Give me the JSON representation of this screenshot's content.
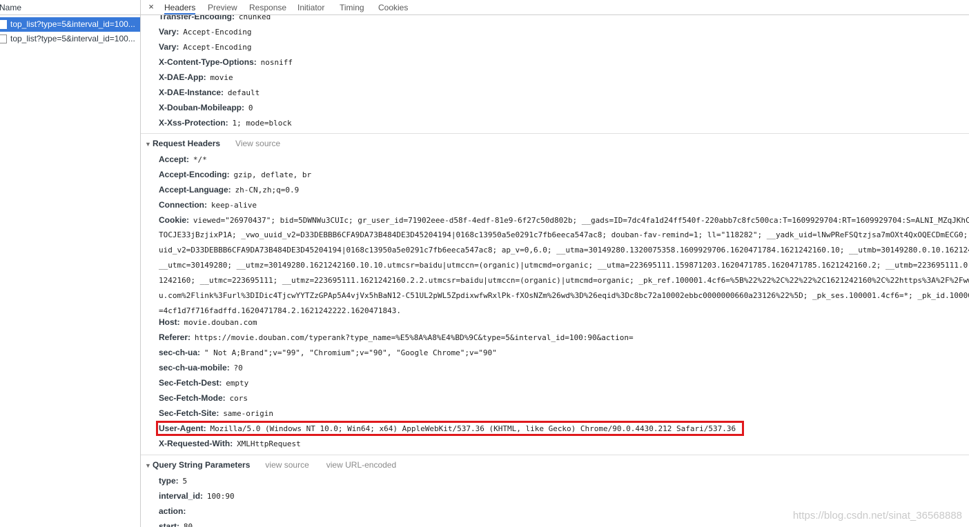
{
  "request_list": {
    "column_header": "Name",
    "items": [
      {
        "label": "top_list?type=5&interval_id=100..."
      },
      {
        "label": "top_list?type=5&interval_id=100..."
      }
    ]
  },
  "tabs": {
    "close_label": "×",
    "items": [
      "Headers",
      "Preview",
      "Response",
      "Initiator",
      "Timing",
      "Cookies"
    ],
    "active": "Headers"
  },
  "response_headers": [
    {
      "key": "Transfer-Encoding:",
      "value": "chunked"
    },
    {
      "key": "Vary:",
      "value": "Accept-Encoding"
    },
    {
      "key": "Vary:",
      "value": "Accept-Encoding"
    },
    {
      "key": "X-Content-Type-Options:",
      "value": "nosniff"
    },
    {
      "key": "X-DAE-App:",
      "value": "movie"
    },
    {
      "key": "X-DAE-Instance:",
      "value": "default"
    },
    {
      "key": "X-Douban-Mobileapp:",
      "value": "0"
    },
    {
      "key": "X-Xss-Protection:",
      "value": "1; mode=block"
    }
  ],
  "request_section": {
    "title": "Request Headers",
    "view_source": "View source"
  },
  "request_headers": {
    "accept": {
      "key": "Accept:",
      "value": "*/*"
    },
    "accept_encoding": {
      "key": "Accept-Encoding:",
      "value": "gzip, deflate, br"
    },
    "accept_language": {
      "key": "Accept-Language:",
      "value": "zh-CN,zh;q=0.9"
    },
    "connection": {
      "key": "Connection:",
      "value": "keep-alive"
    },
    "cookie": {
      "key": "Cookie:",
      "lines": [
        "viewed=\"26970437\"; bid=5DWNWu3CUIc; gr_user_id=71902eee-d58f-4edf-81e9-6f27c50d802b; __gads=ID=7dc4fa1d24ff540f-220abb7c8fc500ca:T=1609929704:RT=1609929704:S=ALNI_MZqJKhCI",
        "TOCJE33jBzjixP1A; _vwo_uuid_v2=D33DEBBB6CFA9DA73B484DE3D45204194|0168c13950a5e0291c7fb6eeca547ac8; douban-fav-remind=1; ll=\"118282\"; __yadk_uid=lNwPReFSQtzjsa7mOXt4QxOQECDmECG0;",
        "uid_v2=D33DEBBB6CFA9DA73B484DE3D45204194|0168c13950a5e0291c7fb6eeca547ac8; ap_v=0,6.0; __utma=30149280.1320075358.1609929706.1620471784.1621242160.10; __utmb=30149280.0.10.162124",
        "__utmc=30149280; __utmz=30149280.1621242160.10.10.utmcsr=baidu|utmccn=(organic)|utmcmd=organic; __utma=223695111.159871203.1620471785.1620471785.1621242160.2; __utmb=223695111.0.",
        "1242160; __utmc=223695111; __utmz=223695111.1621242160.2.2.utmcsr=baidu|utmccn=(organic)|utmcmd=organic; _pk_ref.100001.4cf6=%5B%22%22%2C%22%22%2C1621242160%2C%22https%3A%2F%2Fww",
        "u.com%2Flink%3Furl%3DIDic4TjcwYYTZzGPAp5A4vjVx5hBaN12-C51UL2pWL5ZpdixwfwRxlPk-fXOsNZm%26wd%3D%26eqid%3Dc8bc72a10002ebbc0000000660a23126%22%5D; _pk_ses.100001.4cf6=*; _pk_id.10000",
        "=4cf1d7f716fadffd.1620471784.2.1621242222.1620471843."
      ]
    },
    "host": {
      "key": "Host:",
      "value": "movie.douban.com"
    },
    "referer": {
      "key": "Referer:",
      "value": "https://movie.douban.com/typerank?type_name=%E5%8A%A8%E4%BD%9C&type=5&interval_id=100:90&action="
    },
    "sec_ch_ua": {
      "key": "sec-ch-ua:",
      "value": "\" Not A;Brand\";v=\"99\", \"Chromium\";v=\"90\", \"Google Chrome\";v=\"90\""
    },
    "sec_ch_ua_mobile": {
      "key": "sec-ch-ua-mobile:",
      "value": "?0"
    },
    "sec_fetch_dest": {
      "key": "Sec-Fetch-Dest:",
      "value": "empty"
    },
    "sec_fetch_mode": {
      "key": "Sec-Fetch-Mode:",
      "value": "cors"
    },
    "sec_fetch_site": {
      "key": "Sec-Fetch-Site:",
      "value": "same-origin"
    },
    "user_agent": {
      "key": "User-Agent:",
      "value": "Mozilla/5.0 (Windows NT 10.0; Win64; x64) AppleWebKit/537.36 (KHTML, like Gecko) Chrome/90.0.4430.212 Safari/537.36"
    },
    "x_requested_with": {
      "key": "X-Requested-With:",
      "value": "XMLHttpRequest"
    }
  },
  "query_section": {
    "title": "Query String Parameters",
    "view_source": "view source",
    "view_url_encoded": "view URL-encoded"
  },
  "query_params": {
    "type": {
      "key": "type:",
      "value": "5"
    },
    "interval_id": {
      "key": "interval_id:",
      "value": "100:90"
    },
    "action": {
      "key": "action:",
      "value": ""
    },
    "start": {
      "key": "start:",
      "value": "80"
    }
  },
  "watermark": "https://blog.csdn.net/sinat_36568888",
  "colors": {
    "selection": "#3879d9",
    "highlight_border": "#e0191d"
  }
}
